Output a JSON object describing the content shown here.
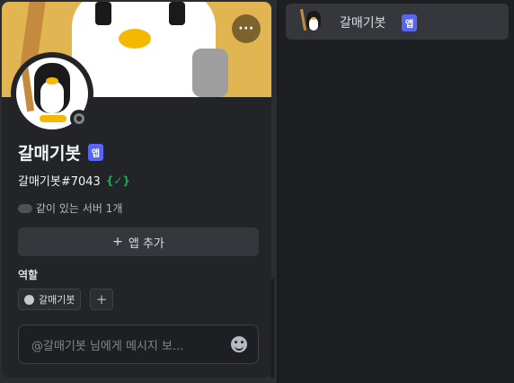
{
  "profile": {
    "display_name": "갈매기봇",
    "app_badge": "앱",
    "username_tag": "갈매기봇#7043",
    "verified_icon": "{✓}",
    "mutual_servers": "같이 있는 서버 1개",
    "add_app_label": "앱 추가",
    "roles_heading": "역할",
    "role_name": "갈매기봇",
    "role_add_label": "+",
    "message_placeholder": "@갈매기봇 님에게 메시지 보...",
    "more_label": "···"
  },
  "member_list": {
    "items": [
      {
        "name": "갈매기봇",
        "badge": "앱"
      }
    ]
  },
  "colors": {
    "accent": "#5865f2",
    "banner": "#e2b553",
    "status_offline": "#80848e",
    "verified": "#23a55a"
  },
  "icons": [
    "more-icon",
    "plus-icon",
    "emoji-icon",
    "status-offline-icon",
    "server-icon"
  ]
}
